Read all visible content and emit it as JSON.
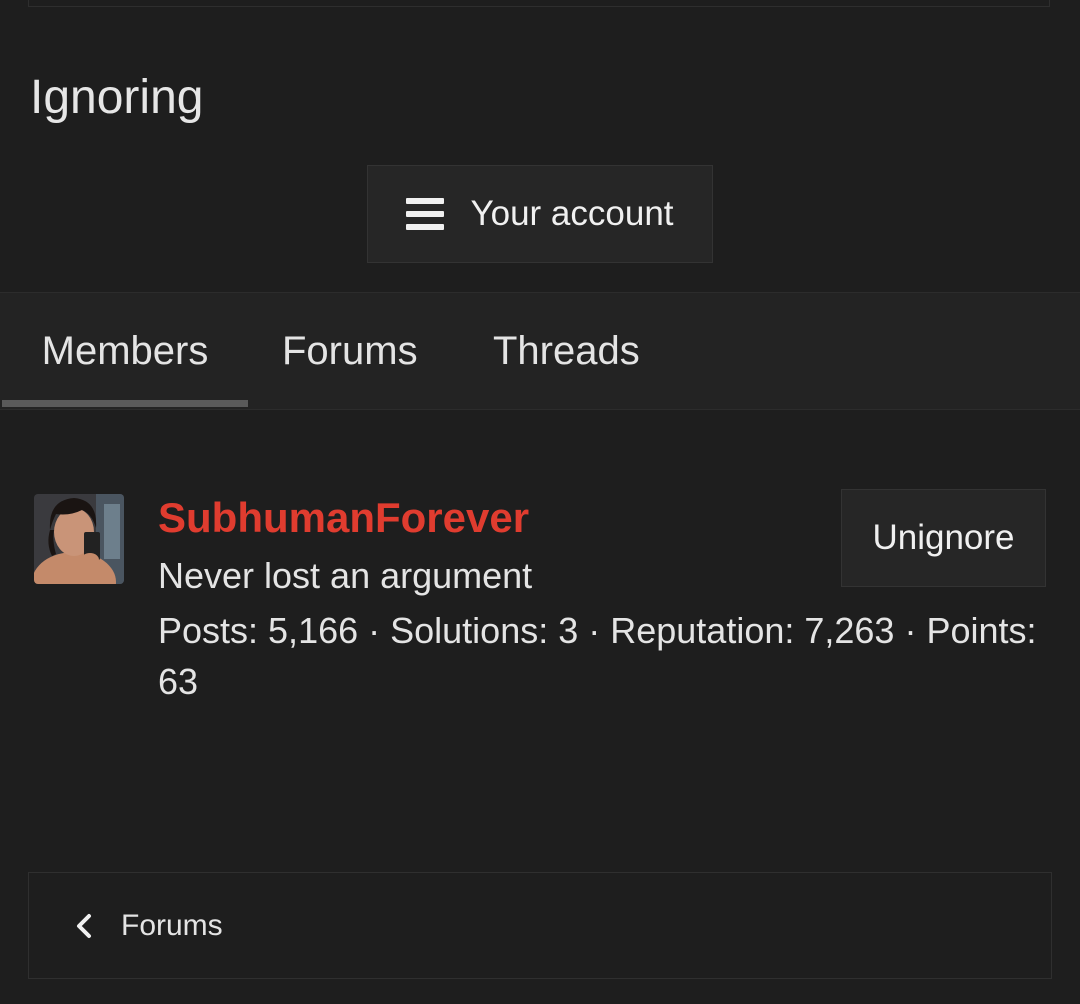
{
  "page": {
    "title": "Ignoring"
  },
  "account_menu": {
    "icon": "hamburger-icon",
    "label": "Your account"
  },
  "tabs": [
    {
      "label": "Members",
      "active": true
    },
    {
      "label": "Forums",
      "active": false
    },
    {
      "label": "Threads",
      "active": false
    }
  ],
  "ignored_members": [
    {
      "username": "SubhumanForever",
      "username_color": "#e03c2f",
      "user_title": "Never lost an argument",
      "stats": "Posts: 5,166 · Solutions: 3 · Reputation: 7,263 · Points: 63",
      "action_label": "Unignore"
    }
  ],
  "breadcrumb": {
    "icon": "chevron-left-icon",
    "label": "Forums"
  }
}
